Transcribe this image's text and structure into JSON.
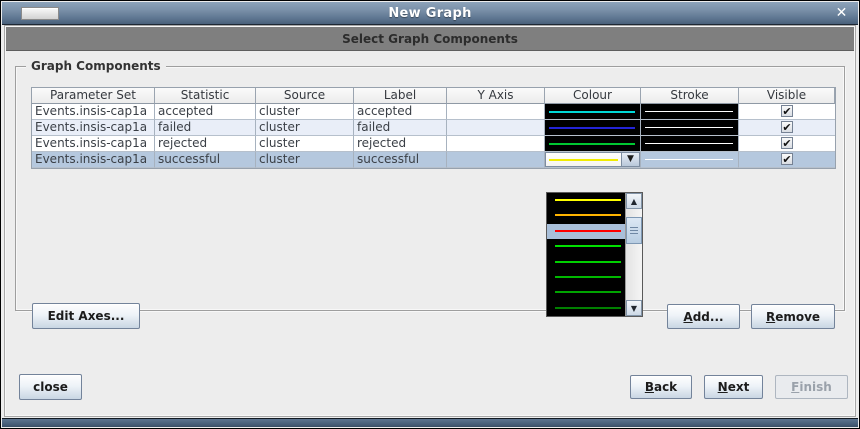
{
  "window": {
    "title": "New Graph"
  },
  "banner": {
    "title": "Select Graph Components"
  },
  "group": {
    "title": "Graph Components"
  },
  "icons": {
    "close": "✕",
    "check": "✔",
    "dropdown_arrow": "▼",
    "scroll_up": "▲",
    "scroll_down": "▼"
  },
  "colors": {
    "selected_row_bg": "#b5c8de",
    "alt_row_bg": "#e9eef8",
    "row_bg": "#ffffff",
    "swatch_bg": "#000000",
    "stroke_preview": "#ffffff",
    "popup_selected_bg": "#a9bfd9"
  },
  "table": {
    "columns": [
      "Parameter Set",
      "Statistic",
      "Source",
      "Label",
      "Y Axis",
      "Colour",
      "Stroke",
      "Visible"
    ],
    "rows": [
      {
        "parameter_set": "Events.insis-cap1a",
        "statistic": "accepted",
        "source": "cluster",
        "label": "accepted",
        "y_axis": "",
        "colour": "#00d8d8",
        "stroke": "#ffffff",
        "visible": true,
        "selected": false,
        "editor_open": false
      },
      {
        "parameter_set": "Events.insis-cap1a",
        "statistic": "failed",
        "source": "cluster",
        "label": "failed",
        "y_axis": "",
        "colour": "#2424d8",
        "stroke": "#ffffff",
        "visible": true,
        "selected": false,
        "editor_open": false
      },
      {
        "parameter_set": "Events.insis-cap1a",
        "statistic": "rejected",
        "source": "cluster",
        "label": "rejected",
        "y_axis": "",
        "colour": "#00c832",
        "stroke": "#ffffff",
        "visible": true,
        "selected": false,
        "editor_open": false
      },
      {
        "parameter_set": "Events.insis-cap1a",
        "statistic": "successful",
        "source": "cluster",
        "label": "successful",
        "y_axis": "",
        "colour": "#f0ec00",
        "stroke": "#ffffff",
        "visible": true,
        "selected": true,
        "editor_open": true
      }
    ]
  },
  "colour_dropdown": {
    "items": [
      {
        "colour": "#ffff00",
        "selected": false
      },
      {
        "colour": "#ffb400",
        "selected": false
      },
      {
        "colour": "#ff0000",
        "selected": true
      },
      {
        "colour": "#00e000",
        "selected": false
      },
      {
        "colour": "#00d000",
        "selected": false
      },
      {
        "colour": "#00b800",
        "selected": false
      },
      {
        "colour": "#00a400",
        "selected": false
      },
      {
        "colour": "#008000",
        "selected": false
      }
    ]
  },
  "buttons": {
    "edit_axes": {
      "label": "Edit Axes...",
      "mnemonic": -1,
      "disabled": false
    },
    "add": {
      "label": "Add...",
      "mnemonic": 0,
      "disabled": false
    },
    "remove": {
      "label": "Remove",
      "mnemonic": 0,
      "disabled": false
    },
    "close": {
      "label": "close",
      "mnemonic": -1,
      "disabled": false
    },
    "back": {
      "label": "Back",
      "mnemonic": 0,
      "disabled": false
    },
    "next": {
      "label": "Next",
      "mnemonic": 0,
      "disabled": false
    },
    "finish": {
      "label": "Finish",
      "mnemonic": 0,
      "disabled": true
    }
  }
}
